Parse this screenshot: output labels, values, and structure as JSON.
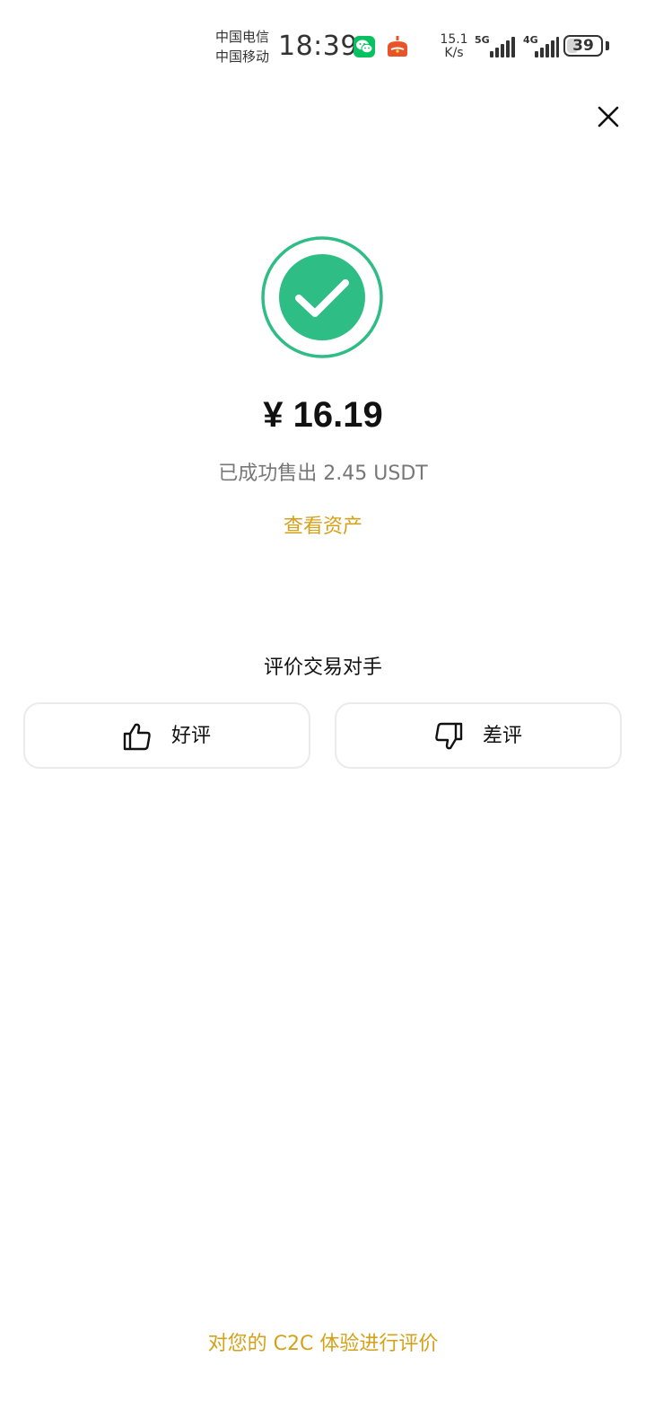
{
  "status_bar": {
    "carrier_1": "中国电信",
    "carrier_2": "中国移动",
    "time": "18:39",
    "net_speed_value": "15.1",
    "net_speed_unit": "K/s",
    "signal_1_label": "5G",
    "signal_2_label": "4G",
    "battery_level": "39",
    "battery_fraction": 0.39,
    "notification_icons": [
      "wechat-icon",
      "app-notification-icon"
    ]
  },
  "header": {
    "close_icon": "close-icon"
  },
  "result": {
    "status_icon": "success-check-icon",
    "amount": "¥ 16.19",
    "sold_description": "已成功售出 2.45 USDT",
    "view_assets_label": "查看资产"
  },
  "rating": {
    "title": "评价交易对手",
    "good_label": "好评",
    "good_icon": "thumbs-up-icon",
    "bad_label": "差评",
    "bad_icon": "thumbs-down-icon"
  },
  "footer": {
    "rate_experience_label": "对您的 C2C 体验进行评价"
  },
  "colors": {
    "success_green": "#2ebd85",
    "accent_gold": "#d4a11a",
    "text_secondary": "#777777",
    "border": "#ebebeb"
  }
}
